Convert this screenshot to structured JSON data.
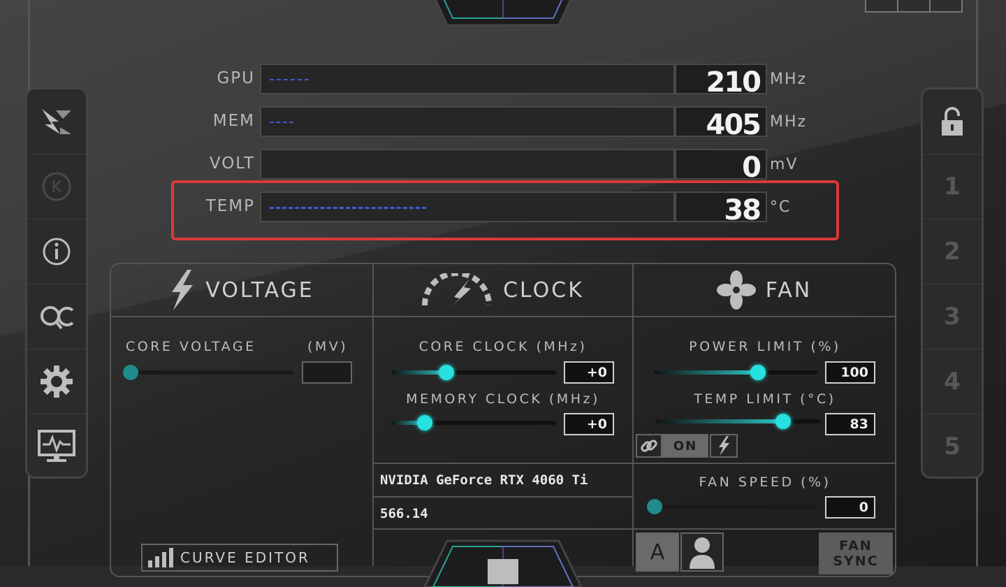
{
  "monitor": {
    "rows": [
      {
        "label": "GPU",
        "value": "210",
        "unit": "MHz",
        "level": 0.1
      },
      {
        "label": "MEM",
        "value": "405",
        "unit": "MHz",
        "level": 0.06
      },
      {
        "label": "VOLT",
        "value": "0",
        "unit": "mV",
        "level": 0
      },
      {
        "label": "TEMP",
        "value": "38",
        "unit": "°C",
        "level": 0.4
      }
    ]
  },
  "tabs": {
    "voltage": "VOLTAGE",
    "clock": "CLOCK",
    "fan": "FAN"
  },
  "voltage": {
    "core_voltage_label": "CORE VOLTAGE",
    "core_voltage_unit": "(MV)",
    "core_voltage_value": ""
  },
  "clock": {
    "core_clock_label": "CORE CLOCK (MHz)",
    "core_clock_value": "+0",
    "memory_clock_label": "MEMORY CLOCK (MHz)",
    "memory_clock_value": "+0"
  },
  "fan": {
    "power_limit_label": "POWER LIMIT (%)",
    "power_limit_value": "100",
    "temp_limit_label": "TEMP LIMIT (°C)",
    "temp_limit_value": "83",
    "link_on_label": "ON",
    "fan_speed_label": "FAN SPEED (%)",
    "fan_speed_value": "0",
    "auto_label": "A",
    "fan_sync_label_1": "FAN",
    "fan_sync_label_2": "SYNC"
  },
  "gpu_info": {
    "name": "NVIDIA GeForce RTX 4060 Ti",
    "driver": "566.14"
  },
  "curve_editor_label": "CURVE EDITOR",
  "profiles": [
    "1",
    "2",
    "3",
    "4",
    "5"
  ],
  "colors": {
    "accent": "#27e1e1",
    "highlight": "#d93a3a",
    "graph_line": "#3d5bd6"
  },
  "left_sidebar_icons": [
    "kombustor-icon",
    "k-icon",
    "info-icon",
    "oc-scanner-icon",
    "settings-icon",
    "monitor-icon"
  ],
  "right_sidebar_icons": [
    "lock-icon"
  ]
}
